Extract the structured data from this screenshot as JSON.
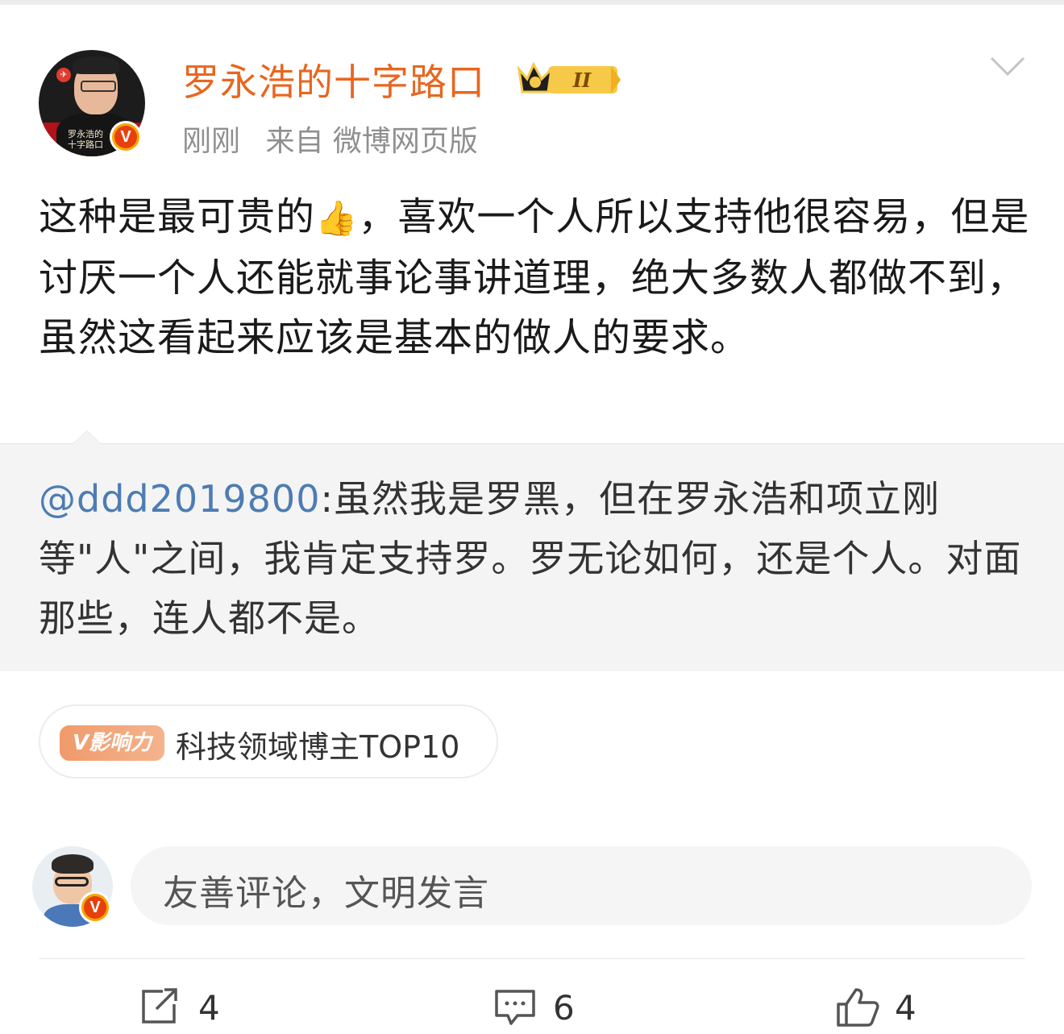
{
  "post": {
    "author": "罗永浩的十字路口",
    "rank_badge": "II",
    "avatar_caption": "罗永浩的十字路口",
    "time": "刚刚",
    "source": "来自 微博网页版",
    "body_before_emoji": "这种是最可贵的",
    "emoji": "👍",
    "body_after_emoji": "，喜欢一个人所以支持他很容易，但是讨厌一个人还能就事论事讲道理，绝大多数人都做不到，虽然这看起来应该是基本的做人的要求。"
  },
  "quote": {
    "mention": "@ddd2019800",
    "text": ":虽然我是罗黑，但在罗永浩和项立刚等\"人\"之间，我肯定支持罗。罗无论如何，还是个人。对面那些，连人都不是。"
  },
  "influence": {
    "pill": "V影响力",
    "label": "科技领域博主TOP10"
  },
  "comment_box": {
    "placeholder": "友善评论，文明发言"
  },
  "actions": {
    "repost_count": "4",
    "comment_count": "6",
    "like_count": "4"
  },
  "colors": {
    "author": "#e8661f",
    "mention": "#4d7cb3",
    "verified_badge": "#f6a800"
  }
}
